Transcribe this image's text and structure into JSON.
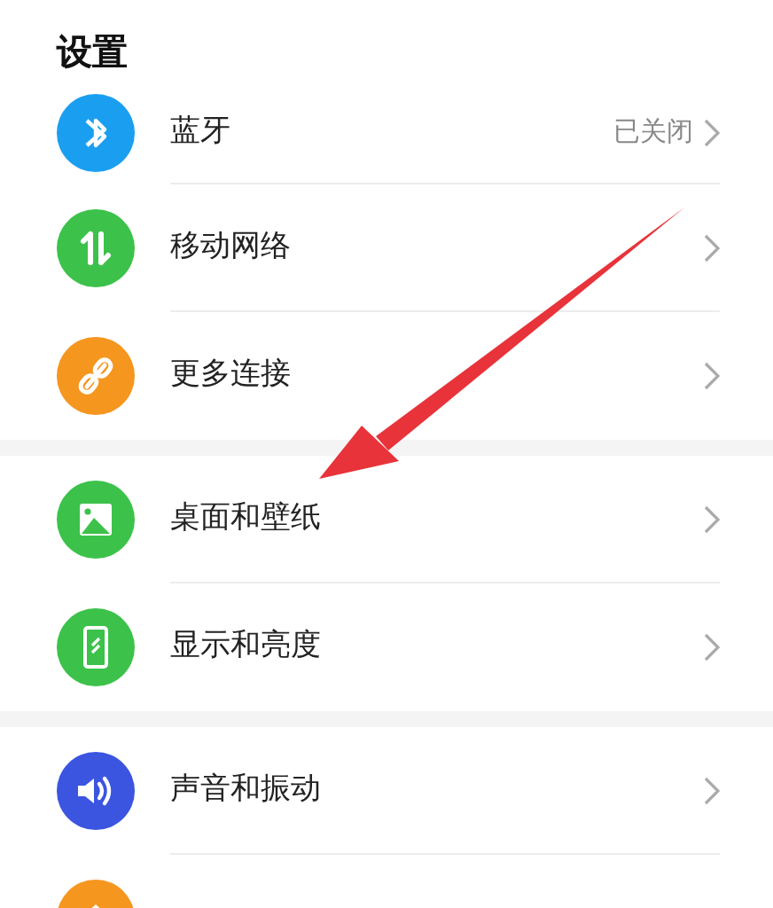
{
  "title": "设置",
  "sections": [
    {
      "items": [
        {
          "kind": "bluetooth",
          "label": "蓝牙",
          "value": "已关闭",
          "color": "#1a9ff0"
        },
        {
          "kind": "network",
          "label": "移动网络",
          "color": "#3cc24a"
        },
        {
          "kind": "link",
          "label": "更多连接",
          "color": "#f5961e"
        }
      ]
    },
    {
      "items": [
        {
          "kind": "image",
          "label": "桌面和壁纸",
          "color": "#3cc24a"
        },
        {
          "kind": "display",
          "label": "显示和亮度",
          "color": "#3cc24a"
        }
      ]
    },
    {
      "items": [
        {
          "kind": "sound",
          "label": "声音和振动",
          "color": "#3b55e0"
        },
        {
          "kind": "home",
          "color": "#f5961e"
        }
      ]
    }
  ]
}
